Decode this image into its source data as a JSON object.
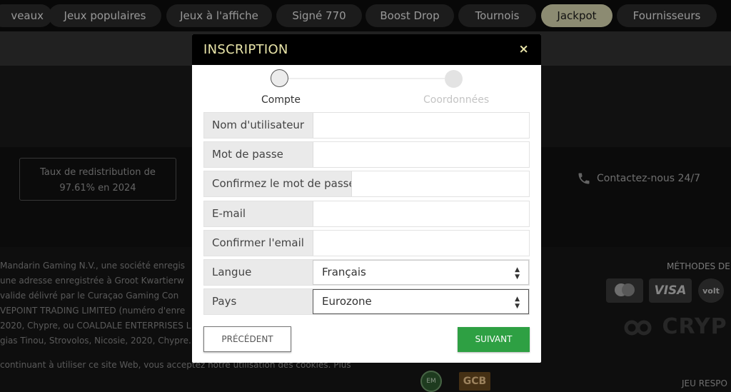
{
  "nav": {
    "items": [
      {
        "label": "Nouveaux",
        "shown": "veaux"
      },
      {
        "label": "Jeux populaires"
      },
      {
        "label": "Jeux à l'affiche"
      },
      {
        "label": "Signé 770"
      },
      {
        "label": "Boost Drop"
      },
      {
        "label": "Tournois"
      },
      {
        "label": "Jackpot",
        "active": true
      },
      {
        "label": "Fournisseurs"
      }
    ]
  },
  "background": {
    "rtp_line1": "Taux de redistribution de",
    "rtp_line2": "97.61% en 2024",
    "contact": "Contactez-nous 24/7",
    "legal_lines": [
      "Mandarin Gaming N.V., une société enregis",
      "une adresse enregistrée à Groot Kwartierw",
      "valide délivré par le Curaçao Gaming Con",
      "VEPOINT TRADING LIMITED (numéro d'enre",
      "2020, Chypre, ou COALDALE ENTERPRISES L",
      "gias Tinou, Strovolos, Nicosie, 2020, Chypre."
    ],
    "cookies": "continuant à utiliser ce site Web, vous acceptez notre utilisation des cookies. Plus",
    "payment_title": "MÉTHODES DE",
    "payments": [
      "mastercard",
      "VISA",
      "volt"
    ],
    "crypto": "CRYP",
    "badge_em": "EM",
    "badge_gcb": "GCB",
    "responsible": "JEU RESPO"
  },
  "modal": {
    "title": "INSCRIPTION",
    "close": "×",
    "steps": [
      {
        "label": "Compte",
        "active": true
      },
      {
        "label": "Coordonnées",
        "active": false
      }
    ],
    "fields": [
      {
        "label": "Nom d'utilisateur",
        "value": ""
      },
      {
        "label": "Mot de passe",
        "value": ""
      },
      {
        "label": "Confirmez le mot de passe",
        "value": ""
      },
      {
        "label": "E-mail",
        "value": ""
      },
      {
        "label": "Confirmer l'email",
        "value": ""
      },
      {
        "label": "Langue",
        "value": "Français"
      },
      {
        "label": "Pays",
        "value": "Eurozone"
      }
    ],
    "prev_label": "PRÉCÉDENT",
    "next_label": "SUIVANT",
    "colors": {
      "header_text": "#e8e4a8",
      "next_button": "#2ea043"
    }
  }
}
